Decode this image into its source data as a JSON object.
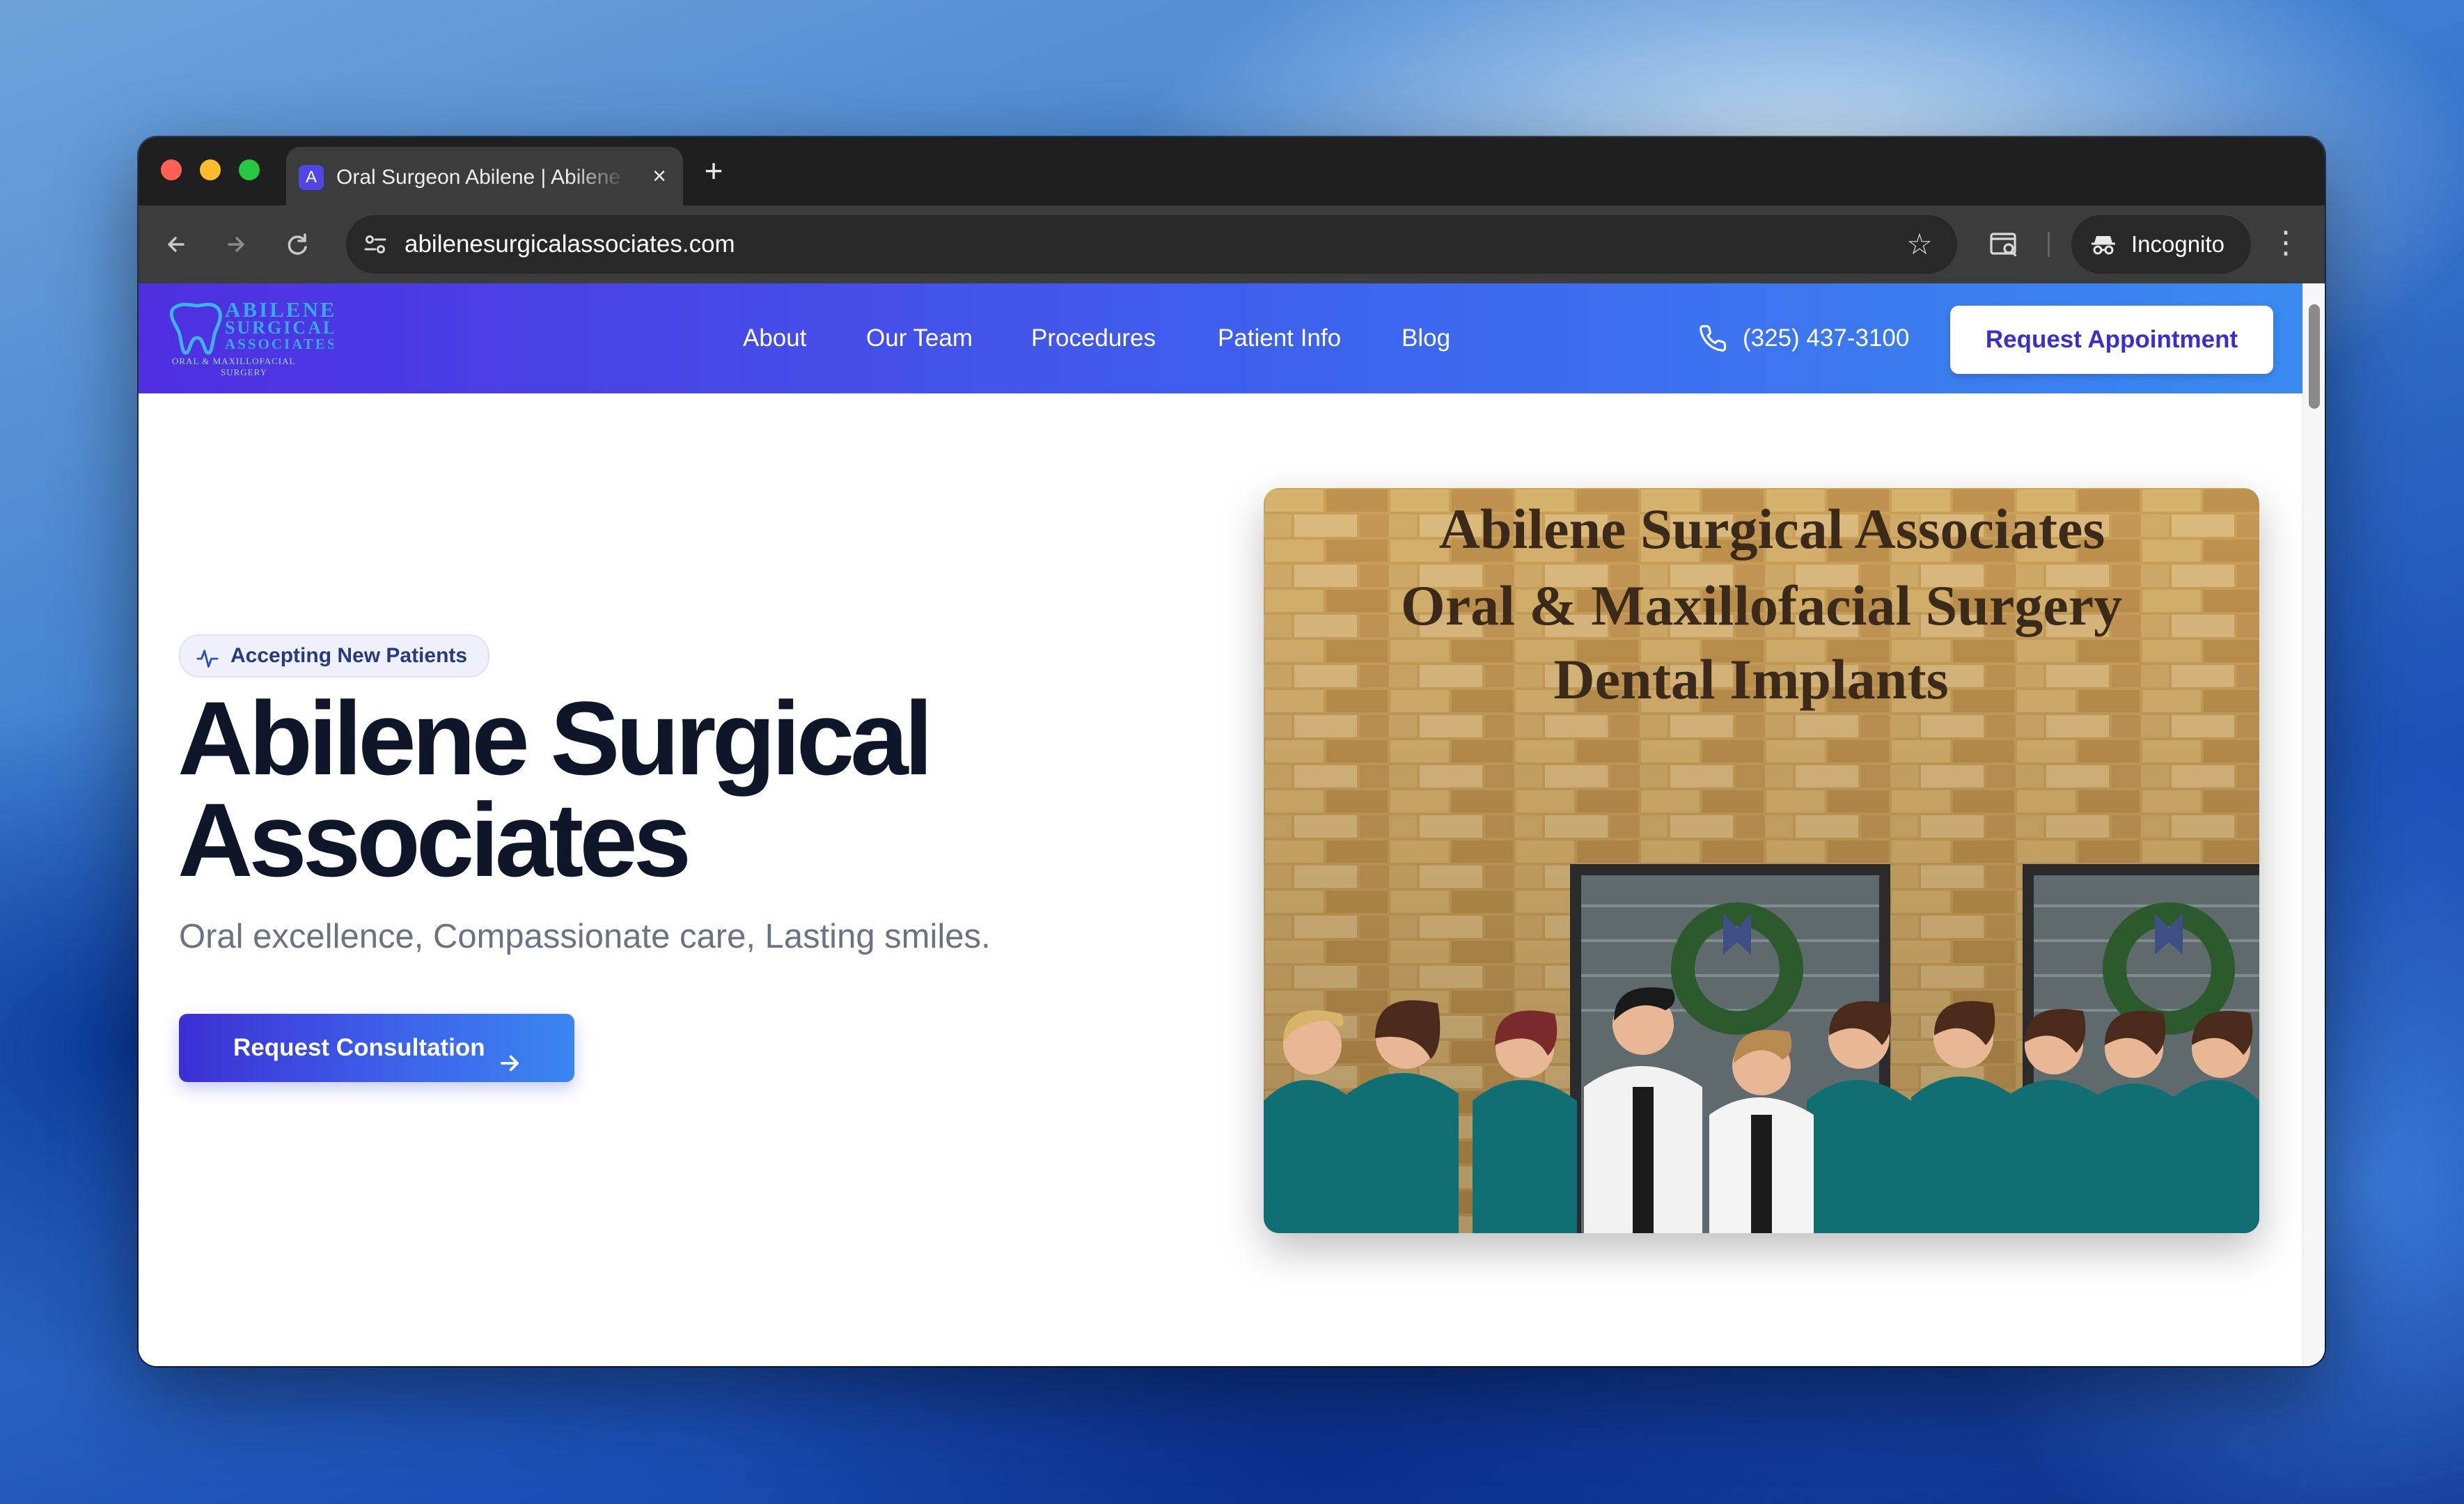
{
  "browser": {
    "tab": {
      "favicon_letter": "A",
      "title": "Oral Surgeon Abilene | Abilene Surgical Associates"
    },
    "omnibox": {
      "url": "abilenesurgicalassociates.com"
    },
    "profile": {
      "label": "Incognito"
    },
    "icons": [
      "back-icon",
      "forward-icon",
      "reload-icon",
      "site-info-icon",
      "bookmark-star-icon",
      "tab-search-icon",
      "incognito-icon",
      "menu-icon",
      "close-icon",
      "plus-icon"
    ]
  },
  "site": {
    "logo": {
      "lines": [
        "ABILENE",
        "SURGICAL",
        "ASSOCIATES"
      ],
      "tagline": [
        "ORAL & MAXILLOFACIAL",
        "SURGERY"
      ]
    },
    "nav": [
      {
        "label": "About"
      },
      {
        "label": "Our Team"
      },
      {
        "label": "Procedures"
      },
      {
        "label": "Patient Info"
      },
      {
        "label": "Blog"
      }
    ],
    "phone": "(325) 437-3100",
    "cta": "Request Appointment",
    "colors": {
      "brand_start": "#4f2fe0",
      "brand_end": "#3a8af0",
      "heading": "#10162a"
    }
  },
  "hero": {
    "badge": "Accepting New Patients",
    "title_line1": "Abilene Surgical",
    "title_line2": "Associates",
    "subtitle": "Oral excellence, Compassionate care, Lasting smiles.",
    "button": "Request Consultation",
    "photo": {
      "sign_lines": [
        "Abilene Surgical Associates",
        "Oral & Maxillofacial Surgery",
        "Dental Implants"
      ]
    }
  }
}
